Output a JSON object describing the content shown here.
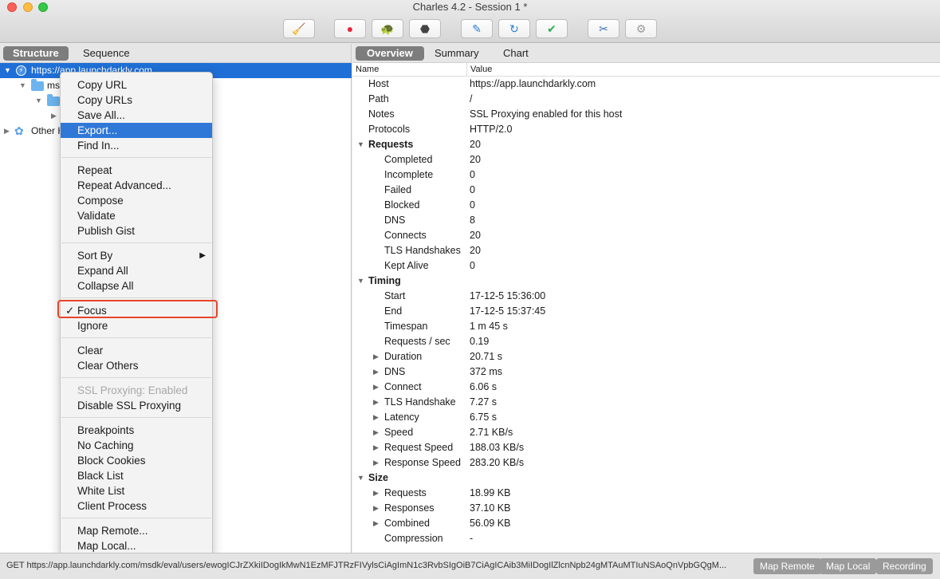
{
  "window": {
    "title": "Charles 4.2 - Session 1 *"
  },
  "toolbar": {
    "buttons": [
      {
        "icon": "broom-icon",
        "glyph": "🧹"
      },
      {
        "icon": "record-icon",
        "glyph": "●"
      },
      {
        "icon": "throttle-icon",
        "glyph": "🐢"
      },
      {
        "icon": "breakpoint-stop-icon",
        "glyph": "⬣"
      },
      {
        "icon": "compose-pen-icon",
        "glyph": "✎"
      },
      {
        "icon": "refresh-icon",
        "glyph": "↻"
      },
      {
        "icon": "validate-check-icon",
        "glyph": "✔"
      },
      {
        "icon": "tools-icon",
        "glyph": "✂"
      },
      {
        "icon": "settings-gear-icon",
        "glyph": "⚙"
      }
    ]
  },
  "left": {
    "tabs": [
      "Structure",
      "Sequence"
    ],
    "active_tab": "Structure",
    "tree": {
      "host": "https://app.launchdarkly.com",
      "folder1": "msdk",
      "other": "Other Hosts"
    }
  },
  "right": {
    "tabs": [
      "Overview",
      "Summary",
      "Chart"
    ],
    "active_tab": "Overview",
    "columns": {
      "name": "Name",
      "value": "Value"
    },
    "rows": [
      {
        "name": "Host",
        "value": "https://app.launchdarkly.com",
        "indent": 0,
        "bold": false,
        "expand": ""
      },
      {
        "name": "Path",
        "value": "/",
        "indent": 0,
        "bold": false,
        "expand": ""
      },
      {
        "name": "Notes",
        "value": "SSL Proxying enabled for this host",
        "indent": 0,
        "bold": false,
        "expand": ""
      },
      {
        "name": "Protocols",
        "value": "HTTP/2.0",
        "indent": 0,
        "bold": false,
        "expand": ""
      },
      {
        "name": "Requests",
        "value": "20",
        "indent": 0,
        "bold": true,
        "expand": "open"
      },
      {
        "name": "Completed",
        "value": "20",
        "indent": 1,
        "bold": false,
        "expand": ""
      },
      {
        "name": "Incomplete",
        "value": "0",
        "indent": 1,
        "bold": false,
        "expand": ""
      },
      {
        "name": "Failed",
        "value": "0",
        "indent": 1,
        "bold": false,
        "expand": ""
      },
      {
        "name": "Blocked",
        "value": "0",
        "indent": 1,
        "bold": false,
        "expand": ""
      },
      {
        "name": "DNS",
        "value": "8",
        "indent": 1,
        "bold": false,
        "expand": ""
      },
      {
        "name": "Connects",
        "value": "20",
        "indent": 1,
        "bold": false,
        "expand": ""
      },
      {
        "name": "TLS Handshakes",
        "value": "20",
        "indent": 1,
        "bold": false,
        "expand": ""
      },
      {
        "name": "Kept Alive",
        "value": "0",
        "indent": 1,
        "bold": false,
        "expand": ""
      },
      {
        "name": "Timing",
        "value": "",
        "indent": 0,
        "bold": true,
        "expand": "open"
      },
      {
        "name": "Start",
        "value": "17-12-5 15:36:00",
        "indent": 1,
        "bold": false,
        "expand": ""
      },
      {
        "name": "End",
        "value": "17-12-5 15:37:45",
        "indent": 1,
        "bold": false,
        "expand": ""
      },
      {
        "name": "Timespan",
        "value": "1 m 45 s",
        "indent": 1,
        "bold": false,
        "expand": ""
      },
      {
        "name": "Requests / sec",
        "value": "0.19",
        "indent": 1,
        "bold": false,
        "expand": ""
      },
      {
        "name": "Duration",
        "value": "20.71 s",
        "indent": 1,
        "bold": false,
        "expand": "closed"
      },
      {
        "name": "DNS",
        "value": "372 ms",
        "indent": 1,
        "bold": false,
        "expand": "closed"
      },
      {
        "name": "Connect",
        "value": "6.06 s",
        "indent": 1,
        "bold": false,
        "expand": "closed"
      },
      {
        "name": "TLS Handshake",
        "value": "7.27 s",
        "indent": 1,
        "bold": false,
        "expand": "closed"
      },
      {
        "name": "Latency",
        "value": "6.75 s",
        "indent": 1,
        "bold": false,
        "expand": "closed"
      },
      {
        "name": "Speed",
        "value": "2.71 KB/s",
        "indent": 1,
        "bold": false,
        "expand": "closed"
      },
      {
        "name": "Request Speed",
        "value": "188.03 KB/s",
        "indent": 1,
        "bold": false,
        "expand": "closed"
      },
      {
        "name": "Response Speed",
        "value": "283.20 KB/s",
        "indent": 1,
        "bold": false,
        "expand": "closed"
      },
      {
        "name": "Size",
        "value": "",
        "indent": 0,
        "bold": true,
        "expand": "open"
      },
      {
        "name": "Requests",
        "value": "18.99 KB",
        "indent": 1,
        "bold": false,
        "expand": "closed"
      },
      {
        "name": "Responses",
        "value": "37.10 KB",
        "indent": 1,
        "bold": false,
        "expand": "closed"
      },
      {
        "name": "Combined",
        "value": "56.09 KB",
        "indent": 1,
        "bold": false,
        "expand": "closed"
      },
      {
        "name": "Compression",
        "value": "-",
        "indent": 1,
        "bold": false,
        "expand": ""
      }
    ]
  },
  "context_menu": {
    "groups": [
      [
        "Copy URL",
        "Copy URLs",
        "Save All...",
        "Export...",
        "Find In..."
      ],
      [
        "Repeat",
        "Repeat Advanced...",
        "Compose",
        "Validate",
        "Publish Gist"
      ],
      [
        "Sort By",
        "Expand All",
        "Collapse All"
      ],
      [
        "Focus",
        "Ignore"
      ],
      [
        "Clear",
        "Clear Others"
      ],
      [
        "SSL Proxying: Enabled",
        "Disable SSL Proxying"
      ],
      [
        "Breakpoints",
        "No Caching",
        "Block Cookies",
        "Black List",
        "White List",
        "Client Process"
      ],
      [
        "Map Remote...",
        "Map Local..."
      ]
    ],
    "highlighted": "Export...",
    "checked": "Focus",
    "disabled": "SSL Proxying: Enabled",
    "has_submenu": "Sort By",
    "check_glyph": "✓",
    "submenu_glyph": "▶"
  },
  "status": {
    "text": "GET https://app.launchdarkly.com/msdk/eval/users/ewogICJrZXkiIDogIkMwN1EzMFJTRzFIVylsCiAgImN1c3RvbSIgOiB7CiAgICAib3MiIDogIlZlcnNpb24gMTAuMTIuNSAoQnVpbGQgM...",
    "buttons": [
      "Map Remote",
      "Map Local",
      "Recording"
    ]
  }
}
